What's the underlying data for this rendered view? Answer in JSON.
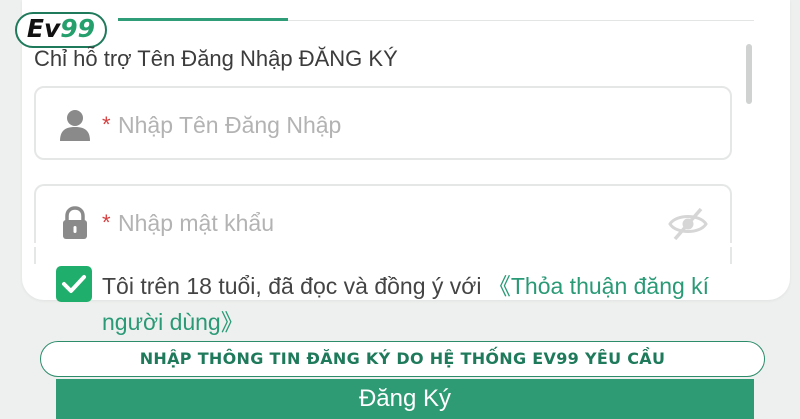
{
  "logo": {
    "text_main": "Ev",
    "text_accent": "99"
  },
  "form": {
    "hint": "Chỉ hỗ trợ Tên Đăng Nhập ĐĂNG KÝ",
    "username": {
      "required_mark": "*",
      "placeholder": "Nhập Tên Đăng Nhập",
      "icon": "user-icon"
    },
    "password": {
      "required_mark": "*",
      "placeholder": "Nhập mật khẩu",
      "icon": "lock-icon",
      "toggle_icon": "eye-off-icon"
    },
    "agreement": {
      "checked": true,
      "text": "Tôi trên 18 tuổi, đã đọc và đồng ý với ",
      "link": "《Thỏa thuận đăng kí người dùng》"
    },
    "submit_label": "Đăng Ký"
  },
  "banner": {
    "text": "NHẬP THÔNG TIN ĐĂNG KÝ DO HỆ THỐNG EV99 YÊU CẦU"
  },
  "colors": {
    "accent": "#2f9b74",
    "required": "#d64040",
    "checkbox": "#1fae6b"
  }
}
